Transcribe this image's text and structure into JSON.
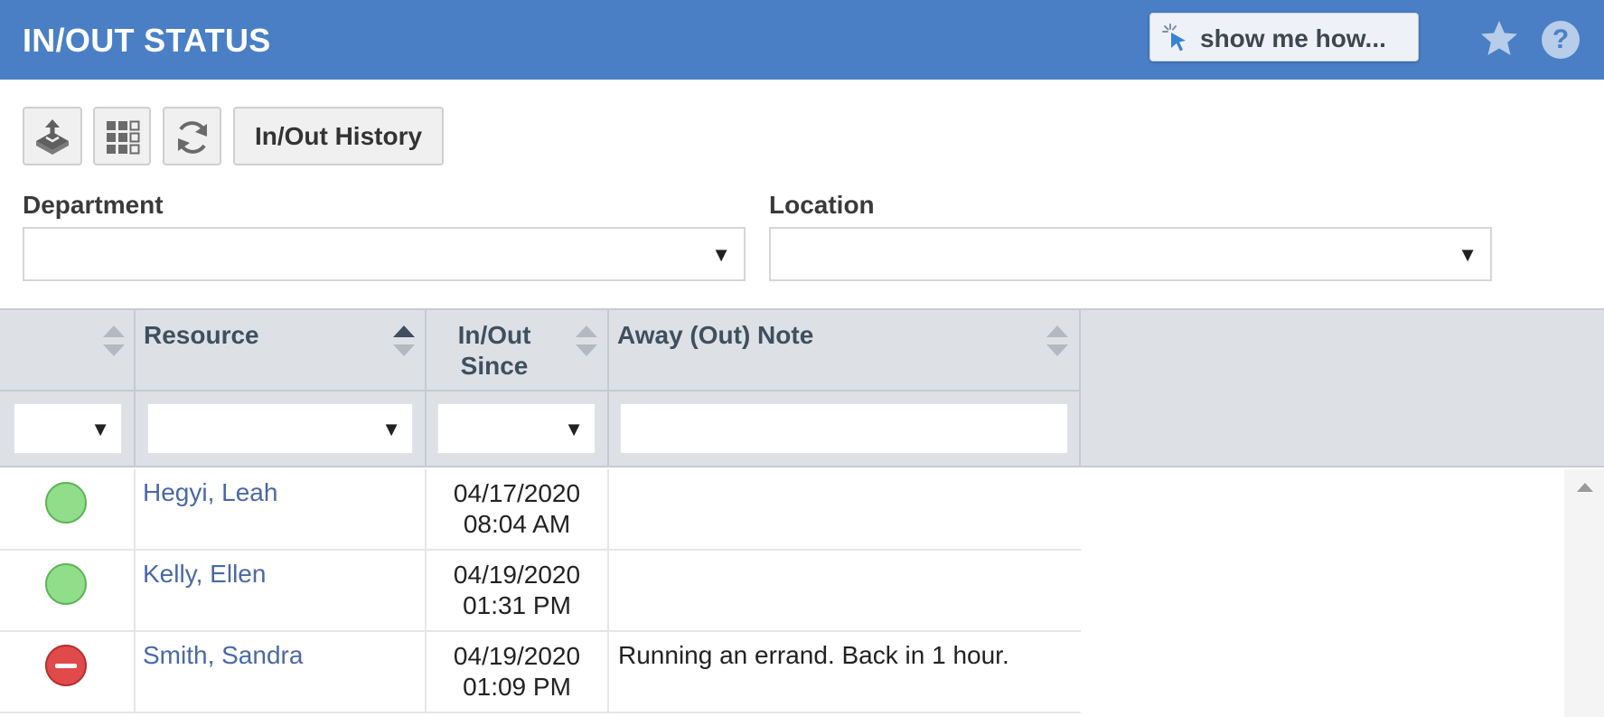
{
  "header": {
    "title": "IN/OUT STATUS",
    "show_me_how": "show me how...",
    "favorite_icon": "star-icon",
    "help_label": "?"
  },
  "toolbar": {
    "export_icon": "export-tray-icon",
    "columns_icon": "grid-columns-icon",
    "refresh_icon": "refresh-icon",
    "history_label": "In/Out History"
  },
  "filters": {
    "department_label": "Department",
    "department_value": "",
    "location_label": "Location",
    "location_value": ""
  },
  "table": {
    "columns": [
      {
        "label": ""
      },
      {
        "label": "Resource"
      },
      {
        "label": "In/Out Since"
      },
      {
        "label": "Away (Out) Note"
      }
    ],
    "sorted_column": "Resource",
    "sort_direction": "ascending",
    "filter_arrow": "▼",
    "status_colors": {
      "in": "#90de89",
      "out": "#e04a4a"
    },
    "rows": [
      {
        "status": "in",
        "resource": "Hegyi, Leah",
        "date": "04/17/2020",
        "time": "08:04 AM",
        "note": ""
      },
      {
        "status": "in",
        "resource": "Kelly, Ellen",
        "date": "04/19/2020",
        "time": "01:31 PM",
        "note": ""
      },
      {
        "status": "out",
        "resource": "Smith, Sandra",
        "date": "04/19/2020",
        "time": "01:09 PM",
        "note": "Running an errand. Back in 1 hour."
      }
    ]
  },
  "colors": {
    "header_bg": "#4a7fc5",
    "link": "#4a68a6",
    "grid_header_bg": "#dde1e5"
  }
}
